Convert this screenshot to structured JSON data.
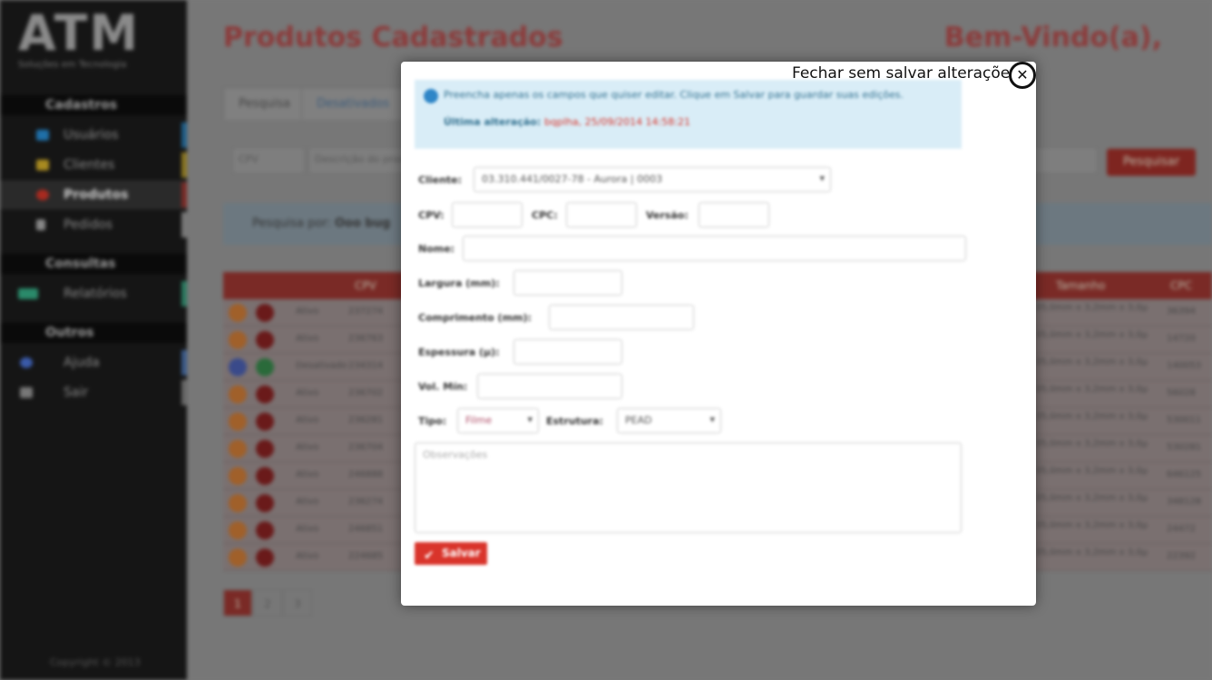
{
  "brand": {
    "logo": "ATM",
    "tagline": "Soluções em Tecnologia"
  },
  "sidebar": {
    "sections": [
      {
        "title": "Cadastros",
        "items": [
          "Usuários",
          "Clientes",
          "Produtos",
          "Pedidos"
        ]
      },
      {
        "title": "Consultas",
        "items": [
          "Relatórios"
        ]
      },
      {
        "title": "Outros",
        "items": [
          "Ajuda",
          "Sair"
        ]
      }
    ],
    "active_item": "Produtos",
    "copyright": "Copyright © 2013"
  },
  "header": {
    "title": "Produtos Cadastrados",
    "welcome": "Bem-Vindo(a),"
  },
  "tabs": [
    "Pesquisa",
    "Desativados"
  ],
  "search": {
    "field1": "CPV",
    "field2": "Descrição do produto",
    "button": "Pesquisar"
  },
  "filter_info": {
    "label": "Pesquisa por:",
    "value": "Ooo bug"
  },
  "table": {
    "headers": {
      "cpv": "CPV",
      "size": "Tamanho",
      "cpc": "CPC"
    },
    "rows": [
      {
        "status": "Ativo",
        "code": "237274",
        "size": "35,0mm x 3,2mm x 3,0μ",
        "cpc": "36394"
      },
      {
        "status": "Ativo",
        "code": "236763",
        "size": "35,0mm x 3,2mm x 3,0μ",
        "cpc": "14720"
      },
      {
        "status": "Desativado",
        "code": "234314",
        "size": "35,0mm x 3,2mm x 3,0μ",
        "cpc": "140053"
      },
      {
        "status": "Ativo",
        "code": "236702",
        "size": "35,0mm x 3,2mm x 3,0μ",
        "cpc": "56028"
      },
      {
        "status": "Ativo",
        "code": "236281",
        "size": "35,0mm x 3,2mm x 3,0μ",
        "cpc": "530011"
      },
      {
        "status": "Ativo",
        "code": "236704",
        "size": "35,0mm x 3,2mm x 3,0μ",
        "cpc": "530281"
      },
      {
        "status": "Ativo",
        "code": "246888",
        "size": "35,0mm x 3,2mm x 3,0μ",
        "cpc": "646125"
      },
      {
        "status": "Ativo",
        "code": "236274",
        "size": "35,0mm x 3,2mm x 3,0μ",
        "cpc": "348128"
      },
      {
        "status": "Ativo",
        "code": "246851",
        "size": "35,0mm x 3,2mm x 3,0μ",
        "cpc": "24472"
      },
      {
        "status": "Ativo",
        "code": "224685",
        "size": "35,0mm x 3,2mm x 3,0μ",
        "cpc": "22392"
      }
    ]
  },
  "pagination": [
    "1",
    "2",
    "3"
  ],
  "modal": {
    "info_text": "Preencha apenas os campos que quiser editar. Clique em Salvar para guardar suas edições.",
    "last_edit_label": "Última alteração:",
    "last_edit_value": "bqplha, 25/09/2014 14:58:21",
    "fields": {
      "cliente_label": "Cliente:",
      "cliente_value": "03.310.441/0027-78 - Aurora | 0003",
      "cpv_label": "CPV:",
      "cpc_label": "CPC:",
      "versao_label": "Versão:",
      "nome_label": "Nome:",
      "largura_label": "Largura (mm):",
      "comprimento_label": "Comprimento (mm):",
      "espessura_label": "Espessura (μ):",
      "volmin_label": "Vol. Mín:",
      "tipo_label": "Tipo:",
      "tipo_value": "Filme",
      "estrutura_label": "Estrutura:",
      "estrutura_value": "PEAD",
      "observacoes_placeholder": "Observações"
    },
    "save_label": "Salvar",
    "close_tooltip": "Fechar sem salvar alterações",
    "close_glyph": "✕"
  },
  "colors": {
    "accent": "#d9342b",
    "info_bg": "#d9edf7",
    "sidebar_bg": "#151515"
  }
}
